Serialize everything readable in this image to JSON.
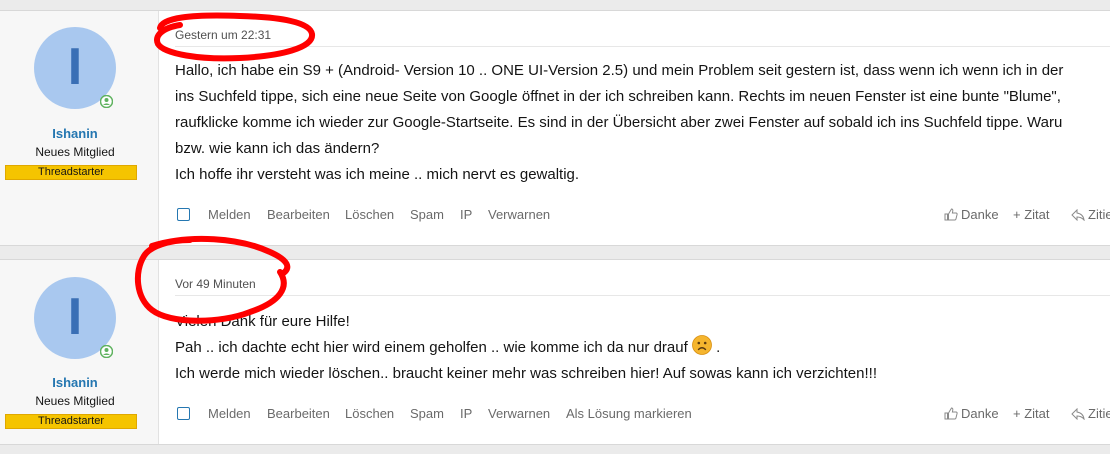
{
  "posts": [
    {
      "user": {
        "avatar_letter": "I",
        "name": "Ishanin",
        "title": "Neues Mitglied",
        "badge": "Threadstarter"
      },
      "date": "Gestern um 22:31",
      "body": [
        "Hallo, ich habe ein S9 + (Android- Version 10 .. ONE UI-Version 2.5) und mein Problem seit gestern ist, dass wenn ich wenn ich in der",
        "ins Suchfeld tippe, sich eine neue Seite von Google öffnet in der ich schreiben kann. Rechts im neuen Fenster ist eine bunte \"Blume\",",
        "raufklicke komme ich wieder zur Google-Startseite. Es sind in der Übersicht aber zwei Fenster auf sobald ich ins Suchfeld tippe. Waru",
        "bzw. wie kann ich das ändern?",
        "Ich hoffe ihr versteht was ich meine .. mich nervt es gewaltig."
      ],
      "actions": [
        "Melden",
        "Bearbeiten",
        "Löschen",
        "Spam",
        "IP",
        "Verwarnen"
      ],
      "right_actions": [
        "Danke",
        "+ Zitat",
        "Zitie"
      ]
    },
    {
      "user": {
        "avatar_letter": "I",
        "name": "Ishanin",
        "title": "Neues Mitglied",
        "badge": "Threadstarter"
      },
      "date": "Vor 49 Minuten",
      "body": [
        "Vielen Dank für eure Hilfe!",
        "Pah .. ich dachte echt hier wird einem geholfen .. wie komme ich da nur drauf",
        "Ich werde mich wieder löschen.. braucht keiner mehr was schreiben hier! Auf sowas kann ich verzichten!!!"
      ],
      "body_after_emoji": " .",
      "actions": [
        "Melden",
        "Bearbeiten",
        "Löschen",
        "Spam",
        "IP",
        "Verwarnen",
        "Als Lösung markieren"
      ],
      "right_actions": [
        "Danke",
        "+ Zitat",
        "Zitie"
      ]
    }
  ],
  "colors": {
    "username": "#2577b1",
    "badge": "#f5c400",
    "annotation": "#ff0000"
  }
}
